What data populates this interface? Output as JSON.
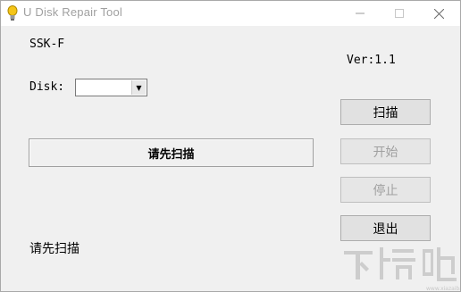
{
  "window": {
    "title": "U Disk Repair Tool",
    "icon": "lightbulb-icon",
    "controls": {
      "minimize": "minimize-icon",
      "maximize": "maximize-icon",
      "close": "close-icon"
    }
  },
  "device": {
    "name": "SSK-F",
    "version": "Ver:1.1"
  },
  "disk": {
    "label": "Disk:",
    "selected": ""
  },
  "status_panel": {
    "text": "请先扫描"
  },
  "buttons": {
    "scan": "扫描",
    "start": "开始",
    "stop": "停止",
    "exit": "退出"
  },
  "bottom_status": {
    "text": "请先扫描"
  },
  "watermark": {
    "logo_text": "下载吧"
  },
  "colors": {
    "background": "#f0f0f0",
    "titlebar": "#ffffff",
    "disabled_text": "#a0a0a0",
    "icon_yellow": "#f5c518"
  }
}
